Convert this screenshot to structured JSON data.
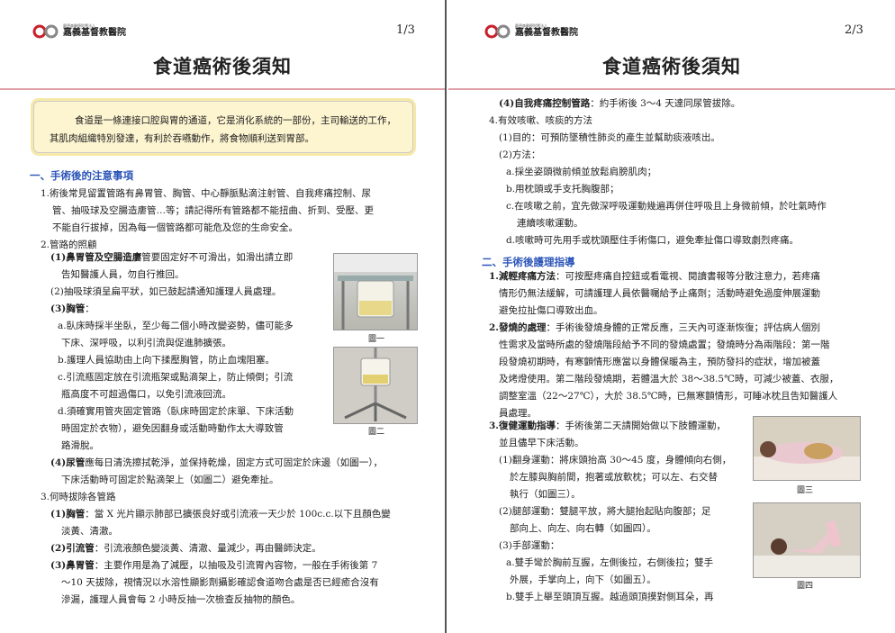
{
  "hospital": {
    "name": "嘉義基督教醫院",
    "small_text": "戴德森醫療財團法人",
    "small_text_en": "DITMANSON MEDICAL FOUNDATION CHIA-YI CHRISTIAN HOSPITAL"
  },
  "page1": {
    "page_number": "1/3",
    "title": "食道癌術後須知",
    "intro": "食道是一條連接口腔與胃的通道，它是消化系統的一部份，主司輸送的工作，其肌肉組織特別發達，有利於吞嚥動作，將食物順利送到胃部。",
    "section1_heading": "一、手術後的注意事項",
    "lines": [
      "1.術後常見留置管路有鼻胃管、胸管、中心靜脈點滴注射管、自我疼痛控制、尿",
      "管、抽吸球及空腸造廔管…等；請記得所有管路都不能扭曲、折到、受壓、更",
      "不能自行拔掉，因為每一個管路都可能危及您的生命安全。",
      "2.管路的照顧"
    ],
    "items": [
      {
        "bold": "(1)鼻胃管及空腸造廔",
        "text": "管要固定好不可滑出，如滑出請立即"
      },
      {
        "bold": "",
        "text": "告知醫護人員，勿自行推回。"
      },
      {
        "bold": "",
        "text": "(2)抽吸球須呈扁平狀，如已鼓起請通知護理人員處理。"
      },
      {
        "bold": "(3)胸管",
        "text": "："
      },
      {
        "bold": "",
        "text": "a.臥床時採半坐臥，至少每二個小時改變姿勢，儘可能多"
      },
      {
        "bold": "",
        "text": "下床、深呼吸，以利引流與促進肺擴張。"
      },
      {
        "bold": "",
        "text": "b.護理人員協助由上向下揉壓胸管，防止血塊阻塞。"
      },
      {
        "bold": "",
        "text": "c.引流瓶固定放在引流瓶架或點滴架上，防止傾倒；引流"
      },
      {
        "bold": "",
        "text": "瓶高度不可超過傷口，以免引流液回流。"
      },
      {
        "bold": "",
        "text": "d.須確實用管夾固定管路（臥床時固定於床單、下床活動"
      },
      {
        "bold": "",
        "text": "時固定於衣物），避免因翻身或活動時動作太大導致管"
      },
      {
        "bold": "",
        "text": "路滑脫。"
      },
      {
        "bold": "(4)尿管",
        "text": "應每日清洗擦拭乾淨，並保持乾燥，固定方式可固定於床邊（如圖一），"
      },
      {
        "bold": "",
        "text": "下床活動時可固定於點滴架上（如圖二）避免牽扯。"
      },
      {
        "bold": "",
        "text": "3.何時拔除各管路"
      },
      {
        "bold": "(1)胸管",
        "text": "：當 X 光片顯示肺部已擴張良好或引流液一天少於 100c.c.以下且顏色變"
      },
      {
        "bold": "",
        "text": "淡黃、清澈。"
      },
      {
        "bold": "(2)引流管",
        "text": "：引流液顏色變淡黃、清澈、量減少，再由醫師決定。"
      },
      {
        "bold": "(3)鼻胃管",
        "text": "：主要作用是為了減壓，以抽吸及引流胃內容物，一般在手術後第 7"
      },
      {
        "bold": "",
        "text": "～10 天拔除，視情況以水溶性顯影劑攝影確認食道吻合處是否已經癒合沒有"
      },
      {
        "bold": "",
        "text": "滲漏，護理人員會每 2 小時反抽一次檢查反抽物的顏色。"
      }
    ],
    "figure1_caption": "圖一",
    "figure2_caption": "圖二"
  },
  "page2": {
    "page_number": "2/3",
    "title": "食道癌術後須知",
    "items_top": [
      {
        "bold": "(4)自我疼痛控制管路",
        "text": "：約手術後 3～4 天達同尿管拔除。"
      },
      {
        "bold": "",
        "text": "4.有效咳嗽、咳痰的方法"
      },
      {
        "bold": "",
        "text": "(1)目的：可預防墜積性肺炎的產生並幫助痰液咳出。"
      },
      {
        "bold": "",
        "text": "(2)方法："
      },
      {
        "bold": "",
        "text": "a.採坐姿頭微前傾並放鬆肩膀肌肉；"
      },
      {
        "bold": "",
        "text": "b.用枕頭或手支托胸腹部；"
      },
      {
        "bold": "",
        "text": "c.在咳嗽之前，宜先做深呼吸運動幾遍再併住呼吸且上身微前傾，於吐氣時作"
      },
      {
        "bold": "",
        "text": "連續咳嗽運動。"
      },
      {
        "bold": "",
        "text": "d.咳嗽時可先用手或枕頭壓住手術傷口，避免牽扯傷口導致劇烈疼痛。"
      }
    ],
    "section2_heading": "二、手術後護理指導",
    "items_bottom": [
      {
        "bold": "1.減輕疼痛方法",
        "text": "：可按壓疼痛自控鈕或看電視、閱讀書報等分散注意力，若疼痛"
      },
      {
        "bold": "",
        "text": "情形仍無法緩解，可請護理人員依醫囑給予止痛劑；活動時避免過度伸展運動"
      },
      {
        "bold": "",
        "text": "避免拉扯傷口導致出血。"
      },
      {
        "bold": "2.發燒的處理",
        "text": "：手術後發燒身體的正常反應，三天內可逐漸恢復；評估病人個別"
      },
      {
        "bold": "",
        "text": "性需求及當時所處的發燒階段給予不同的發燒處置；發燒時分為兩階段：第一階"
      },
      {
        "bold": "",
        "text": "段發燒初期時，有寒顫情形應當以身體保暖為主，預防發抖的症狀，增加被蓋"
      },
      {
        "bold": "",
        "text": "及烤燈使用。第二階段發燒期，若體溫大於 38～38.5℃時，可減少被蓋、衣服，"
      },
      {
        "bold": "",
        "text": "調整室溫（22～27℃），大於 38.5℃時，已無寒顫情形，可睡冰枕且告知醫護人"
      },
      {
        "bold": "",
        "text": "員處理。"
      },
      {
        "bold": "3.復健運動指導",
        "text": "：手術後第二天請開始做以下肢體運動，"
      },
      {
        "bold": "",
        "text": "並且儘早下床活動。"
      },
      {
        "bold": "",
        "text": "(1)翻身運動：將床頭抬高 30～45 度，身體傾向右側，"
      },
      {
        "bold": "",
        "text": "於左膝與胸前間，抱著或放軟枕；可以左、右交替"
      },
      {
        "bold": "",
        "text": "執行（如圖三）。"
      },
      {
        "bold": "",
        "text": "(2)腿部運動：雙腿平放，將大腿抬起貼向腹部；足"
      },
      {
        "bold": "",
        "text": "部向上、向左、向右轉（如圖四）。"
      },
      {
        "bold": "",
        "text": "(3)手部運動："
      },
      {
        "bold": "",
        "text": "a.雙手彎於胸前互握，左側後拉，右側後拉；雙手"
      },
      {
        "bold": "",
        "text": "外展，手掌向上，向下（如圖五）。"
      },
      {
        "bold": "",
        "text": "b.雙手上舉至頭頂互握。越過頭頂摸對側耳朵，再"
      }
    ],
    "figure3_caption": "圖三",
    "figure4_caption": "圖四"
  },
  "colors": {
    "heading_blue": "#2b55b8",
    "rule_pink": "#e0a0a8",
    "intro_bg": "#fdf4d0",
    "logo_red": "#c8202c"
  }
}
